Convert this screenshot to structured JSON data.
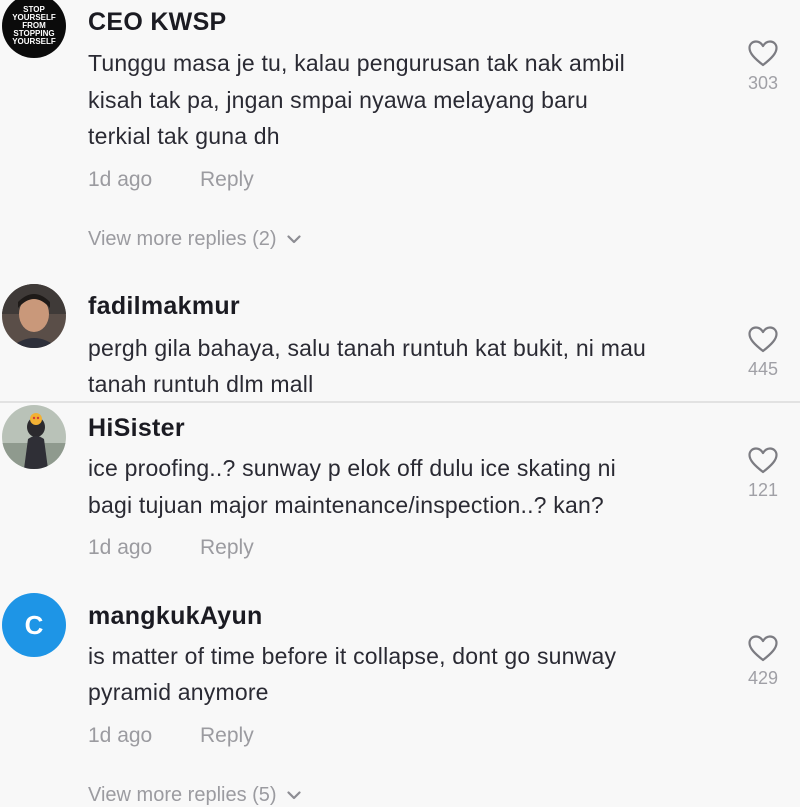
{
  "comments": [
    {
      "username": "CEO KWSP",
      "avatar_text": [
        "STOP",
        "YOURSELF",
        "FROM",
        "STOPPING",
        "YOURSELF"
      ],
      "lines": [
        "Tunggu masa je tu, kalau pengurusan tak nak ambil",
        "kisah tak pa, jngan smpai nyawa melayang baru",
        "terkial tak guna dh"
      ],
      "time": "1d ago",
      "reply": "Reply",
      "view_more": "View more replies (2)",
      "likes": "303"
    },
    {
      "username": "fadilmakmur",
      "lines": [
        "pergh gila bahaya, salu tanah runtuh kat bukit, ni mau",
        "tanah runtuh dlm mall"
      ],
      "likes": "445"
    },
    {
      "username": "HiSister",
      "lines": [
        "ice proofing..? sunway p elok off dulu ice skating ni",
        "bagi tujuan major maintenance/inspection..? kan?"
      ],
      "time": "1d ago",
      "reply": "Reply",
      "likes": "121"
    },
    {
      "username": "mangkukAyun",
      "avatar_letter": "C",
      "lines": [
        "is matter of time before it collapse, dont go sunway",
        "pyramid anymore"
      ],
      "time": "1d ago",
      "reply": "Reply",
      "view_more": "View more replies (5)",
      "likes": "429"
    }
  ],
  "colors": {
    "background": "#f8f8f8",
    "username": "#1b1b22",
    "muted": "#9b9ba0",
    "avatar_blue": "#1e95e6"
  }
}
